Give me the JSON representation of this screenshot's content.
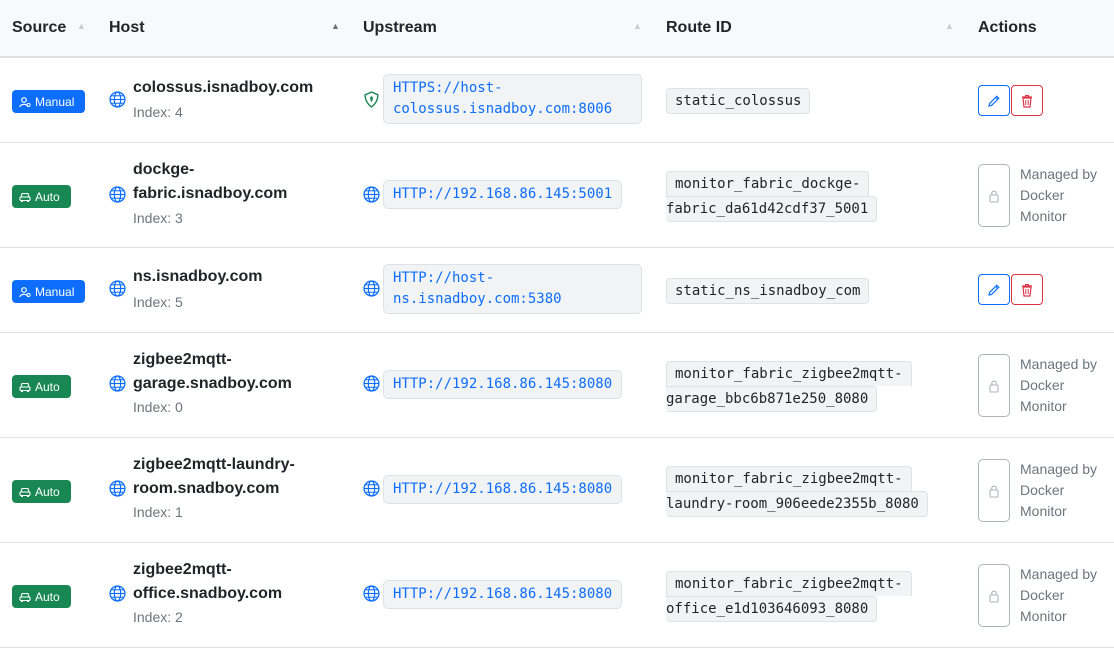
{
  "headers": {
    "source": "Source",
    "host": "Host",
    "upstream": "Upstream",
    "route_id": "Route ID",
    "actions": "Actions"
  },
  "managed_text": {
    "line1": "Managed by",
    "line2": "Docker",
    "line3": "Monitor"
  },
  "rows": [
    {
      "source": "Manual",
      "host_line1": "colossus.isnadboy.com",
      "host_line2": "",
      "index": "Index: 4",
      "upstream_line1": "HTTPS://host-",
      "upstream_line2": "colossus.isnadboy.com:8006",
      "upstream_icon": "shield-icon",
      "route_line1": "static_colossus",
      "route_line2": ""
    },
    {
      "source": "Auto",
      "host_line1": "dockge-",
      "host_line2": "fabric.isnadboy.com",
      "index": "Index: 3",
      "upstream_line1": "HTTP://192.168.86.145:5001",
      "upstream_line2": "",
      "upstream_icon": "globe-icon",
      "route_line1": "monitor_fabric_dockge-",
      "route_line2": "fabric_da61d42cdf37_5001"
    },
    {
      "source": "Manual",
      "host_line1": "ns.isnadboy.com",
      "host_line2": "",
      "index": "Index: 5",
      "upstream_line1": "HTTP://host-",
      "upstream_line2": "ns.isnadboy.com:5380",
      "upstream_icon": "globe-icon",
      "route_line1": "static_ns_isnadboy_com",
      "route_line2": ""
    },
    {
      "source": "Auto",
      "host_line1": "zigbee2mqtt-",
      "host_line2": "garage.snadboy.com",
      "index": "Index: 0",
      "upstream_line1": "HTTP://192.168.86.145:8080",
      "upstream_line2": "",
      "upstream_icon": "globe-icon",
      "route_line1": "monitor_fabric_zigbee2mqtt-",
      "route_line2": "garage_bbc6b871e250_8080"
    },
    {
      "source": "Auto",
      "host_line1": "zigbee2mqtt-laundry-",
      "host_line2": "room.snadboy.com",
      "index": "Index: 1",
      "upstream_line1": "HTTP://192.168.86.145:8080",
      "upstream_line2": "",
      "upstream_icon": "globe-icon",
      "route_line1": "monitor_fabric_zigbee2mqtt-",
      "route_line2": "laundry-room_906eede2355b_8080"
    },
    {
      "source": "Auto",
      "host_line1": "zigbee2mqtt-",
      "host_line2": "office.snadboy.com",
      "index": "Index: 2",
      "upstream_line1": "HTTP://192.168.86.145:8080",
      "upstream_line2": "",
      "upstream_icon": "globe-icon",
      "route_line1": "monitor_fabric_zigbee2mqtt-",
      "route_line2": "office_e1d103646093_8080"
    }
  ],
  "colors": {
    "manual_badge": "#0d6efd",
    "auto_badge": "#198754",
    "link": "#0d6efd",
    "delete": "#dc3545"
  }
}
